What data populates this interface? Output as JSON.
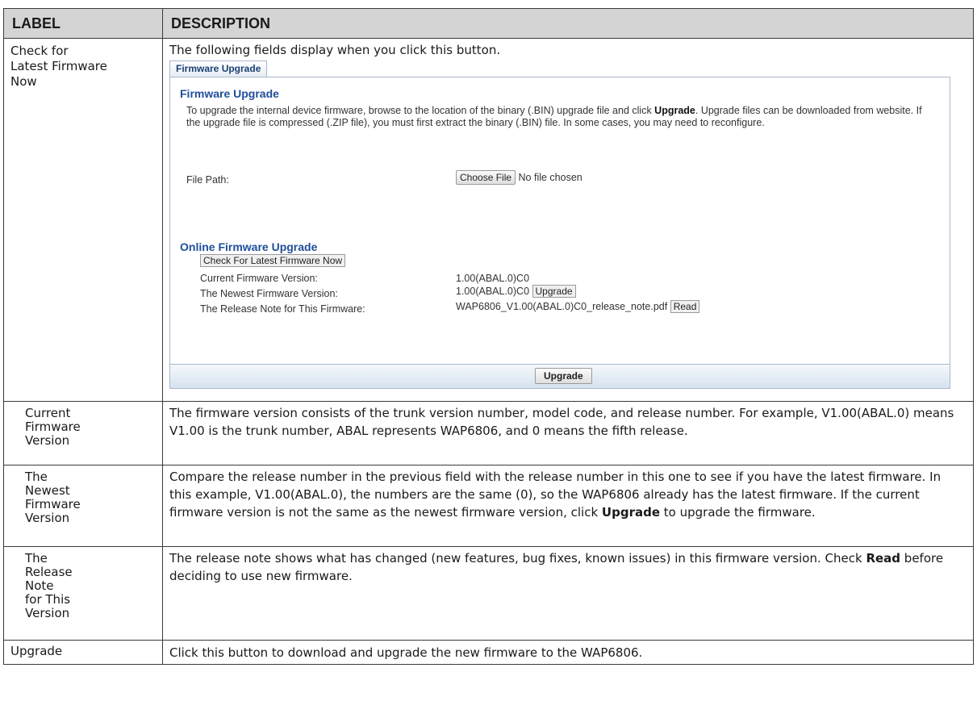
{
  "table": {
    "headers": {
      "label": "LABEL",
      "description": "DESCRIPTION"
    },
    "row1": {
      "label": "Check for Latest Firmware Now",
      "intro": "The following fields display when you click this button."
    },
    "screenshot": {
      "tab": "Firmware Upgrade",
      "section1_title": "Firmware Upgrade",
      "section1_text_pre": "To upgrade the internal device firmware, browse to the location of the binary (.BIN) upgrade file and click ",
      "section1_text_bold": "Upgrade",
      "section1_text_post": ". Upgrade files can be downloaded from website. If the upgrade file is compressed (.ZIP file), you must first extract the binary (.BIN) file. In some cases, you may need to reconfigure.",
      "file_path_label": "File Path:",
      "choose_file_button": "Choose File",
      "no_file_text": "No file chosen",
      "section2_title": "Online Firmware Upgrade",
      "check_latest_button": "Check For Latest Firmware Now",
      "current_version_label": "Current Firmware Version:",
      "current_version_value": "1.00(ABAL.0)C0",
      "newest_version_label": "The Newest Firmware Version:",
      "newest_version_value": "1.00(ABAL.0)C0",
      "inline_upgrade_button": "Upgrade",
      "release_note_label": "The Release Note for This Firmware:",
      "release_note_value": "WAP6806_V1.00(ABAL.0)C0_release_note.pdf",
      "read_button": "Read",
      "footer_upgrade_button": "Upgrade"
    },
    "row2": {
      "label": "Current Firmware Version",
      "description": "The firmware version consists of the trunk version number, model code, and release number. For example, V1.00(ABAL.0) means V1.00 is the trunk number, ABAL represents WAP6806, and 0 means the fifth release."
    },
    "row3": {
      "label": "The Newest Firmware Version",
      "description_pre": "Compare the release number in the previous field with the release number in this one to see if you have the latest firmware. In this example, V1.00(ABAL.0), the numbers are the same (0), so the WAP6806 already has the latest firmware. If the current firmware version is not the same as the newest firmware version, click ",
      "description_bold": "Upgrade",
      "description_post": " to upgrade the firmware."
    },
    "row4": {
      "label": "The Release Note for This Version",
      "description_pre": "The release note shows what has changed (new features, bug fixes, known issues) in this firmware version. Check ",
      "description_bold": "Read",
      "description_post": " before deciding to use new firmware."
    },
    "row5": {
      "label": "Upgrade",
      "description": "Click this button to download and upgrade the new firmware to the WAP6806."
    }
  }
}
